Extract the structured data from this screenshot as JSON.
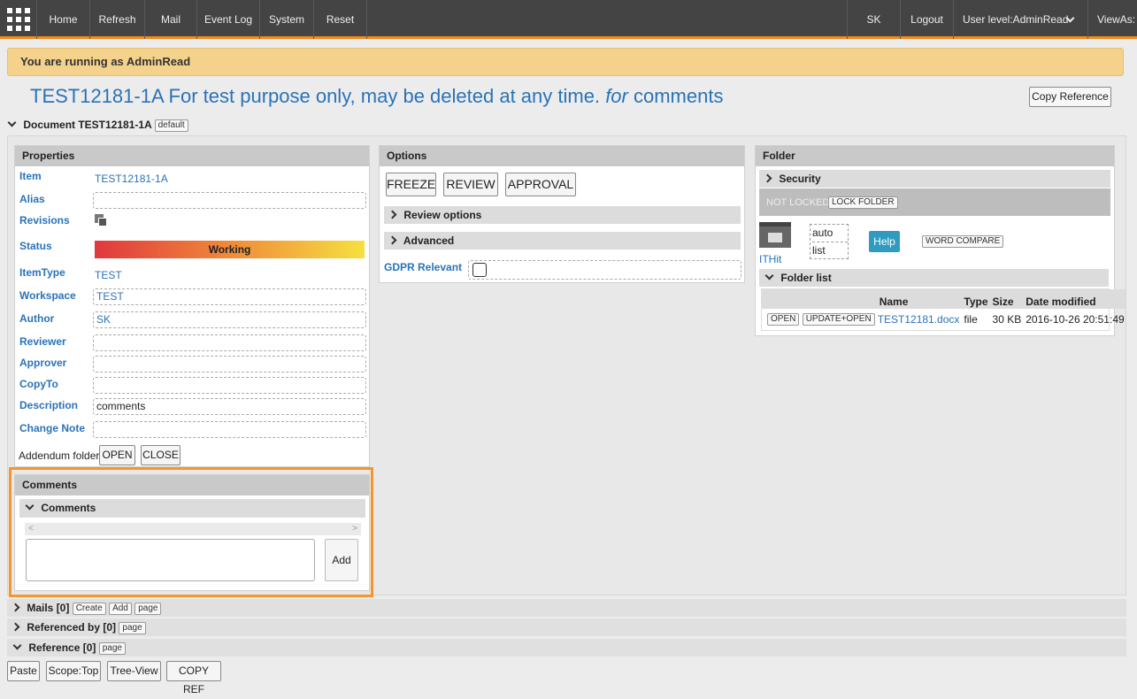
{
  "nav": {
    "items": [
      "Home",
      "Refresh",
      "Mail",
      "Event Log",
      "System",
      "Reset"
    ],
    "user": "SK",
    "logout": "Logout",
    "user_level": "User level:AdminRead",
    "views_as": "ViewAs:"
  },
  "banner": "You are running as AdminRead",
  "title": {
    "main": "TEST12181-1A For test purpose only, may be deleted at any time.",
    "for": "for",
    "suffix": "comments"
  },
  "copy_reference": "Copy Reference",
  "document": {
    "header": "Document TEST12181-1A",
    "default_tag": "default"
  },
  "properties": {
    "title": "Properties",
    "labels": {
      "item": "Item",
      "alias": "Alias",
      "revisions": "Revisions",
      "status": "Status",
      "itemtype": "ItemType",
      "workspace": "Workspace",
      "author": "Author",
      "reviewer": "Reviewer",
      "approver": "Approver",
      "copyto": "CopyTo",
      "description": "Description",
      "change_note": "Change Note"
    },
    "values": {
      "item": "TEST12181-1A",
      "status": "Working",
      "itemtype": "TEST",
      "workspace": "TEST",
      "author": "SK",
      "description": "comments"
    },
    "addendum_label": "Addendum folder",
    "open": "OPEN",
    "close": "CLOSE"
  },
  "comments": {
    "title": "Comments",
    "subtitle": "Comments",
    "add": "Add",
    "input_value": ""
  },
  "options": {
    "title": "Options",
    "buttons": [
      "FREEZE",
      "REVIEW",
      "APPROVAL"
    ],
    "review_options": "Review options",
    "advanced": "Advanced",
    "gdpr": "GDPR Relevant"
  },
  "folder": {
    "title": "Folder",
    "security": "Security",
    "not_locked": "NOT LOCKED",
    "lock_folder": "LOCK FOLDER",
    "ithit": "ITHit",
    "mode_options": [
      "auto",
      "list"
    ],
    "help": "Help",
    "word_compare": "WORD COMPARE",
    "folder_list": "Folder list",
    "columns": [
      "Name",
      "Type",
      "Size",
      "Date modified"
    ],
    "row": {
      "open": "OPEN",
      "update_open": "UPDATE+OPEN",
      "name": "TEST12181.docx",
      "type": "file",
      "size": "30 KB",
      "date": "2016-10-26 20:51:49"
    }
  },
  "sections": {
    "mails": "Mails [0]",
    "create": "Create",
    "add": "Add",
    "page": "page",
    "referenced_by": "Referenced by [0]",
    "reference": "Reference [0]"
  },
  "bottom_buttons": [
    "Paste",
    "Scope:Top",
    "Tree-View",
    "COPY REF"
  ],
  "colors": {
    "accent": "#f08b1c",
    "link": "#2a73b8",
    "help": "#2f9bc1"
  }
}
